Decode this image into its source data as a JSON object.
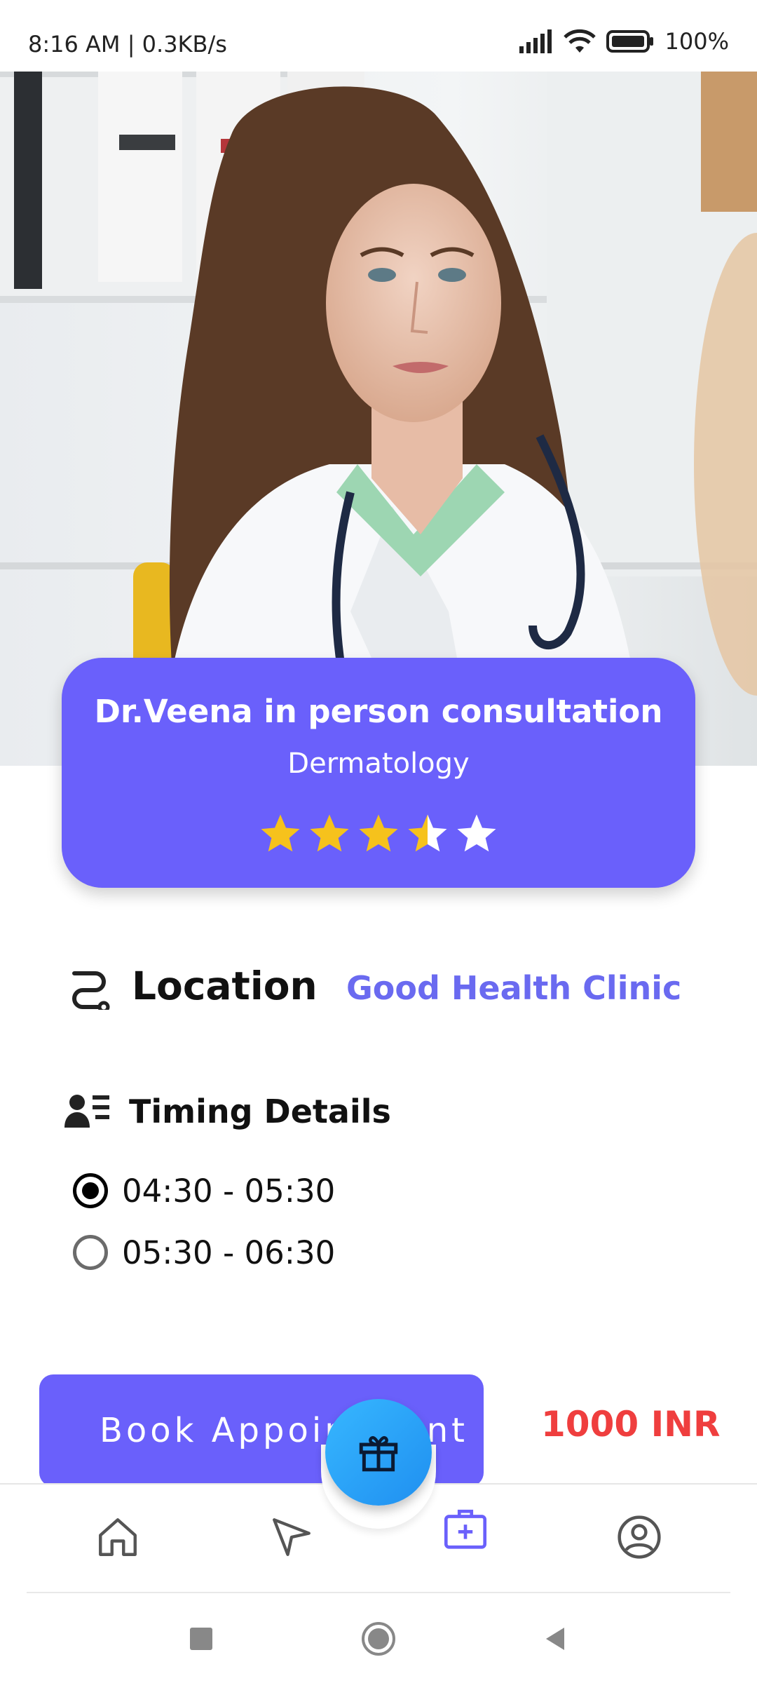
{
  "status_bar": {
    "time": "8:16 AM | 0.3KB/s",
    "battery": "100%"
  },
  "doctor": {
    "title": "Dr.Veena in person consultation",
    "specialty": "Dermatology",
    "rating": 3.5,
    "rating_max": 5
  },
  "location": {
    "label": "Location",
    "value": "Good Health Clinic"
  },
  "timing": {
    "label": "Timing Details",
    "slots": [
      {
        "label": "04:30 - 05:30",
        "selected": true
      },
      {
        "label": "05:30 - 06:30",
        "selected": false
      }
    ]
  },
  "booking": {
    "button_label": "Book Appointment",
    "price": "1000 INR"
  },
  "bottom_nav": {
    "items": [
      "home-icon",
      "send-icon",
      "medical-kit-icon",
      "profile-icon"
    ],
    "active": "medical-kit-icon",
    "fab_icon": "gift-icon"
  },
  "colors": {
    "accent": "#6a60fb",
    "location_value": "#6a6af0",
    "price": "#ef3e3e",
    "star": "#f6c21c"
  }
}
